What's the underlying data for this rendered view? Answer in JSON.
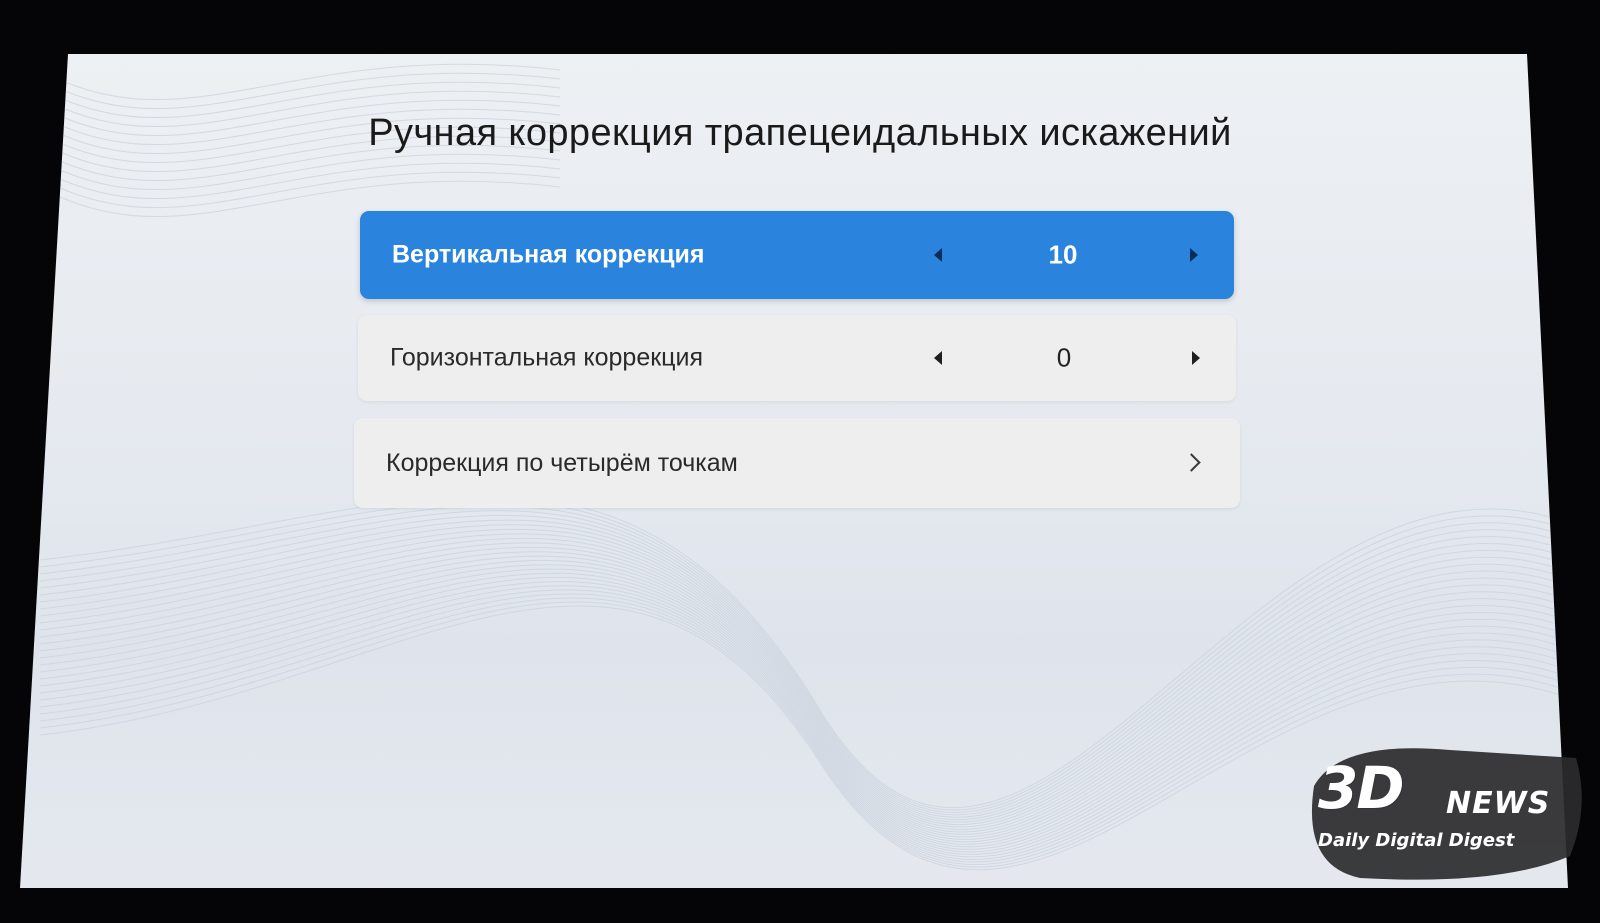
{
  "title": "Ручная коррекция трапецеидальных искажений",
  "items": [
    {
      "label": "Вертикальная коррекция",
      "value": "10",
      "selected": true
    },
    {
      "label": "Горизонтальная коррекция",
      "value": "0",
      "selected": false
    },
    {
      "label": "Коррекция по четырём точкам",
      "selected": false
    }
  ],
  "watermark": {
    "brand": "3D",
    "news": "NEWS",
    "tagline": "Daily Digital Digest"
  },
  "colors": {
    "accent": "#2a84dd",
    "row_bg": "#eeeeef",
    "screen_bg": "#e6eaf0"
  }
}
